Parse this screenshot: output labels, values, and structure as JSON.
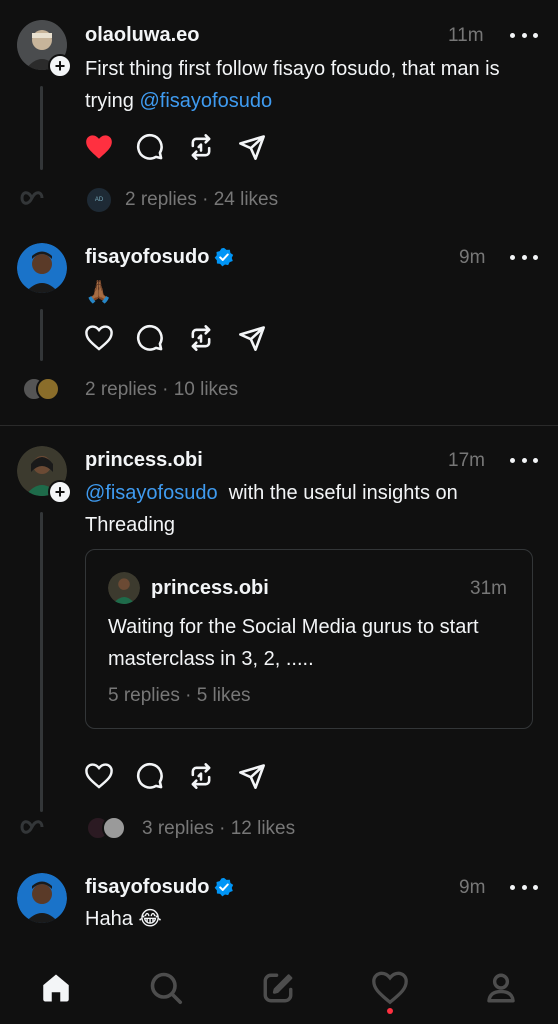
{
  "posts": [
    {
      "username": "olaoluwa.eo",
      "time": "11m",
      "text_line1": "First thing first follow fisayo fosudo, that man is",
      "text_line2_prefix": "trying ",
      "mention": "@fisayofosudo",
      "liked": true,
      "replies_meta": "2 replies · 24 likes",
      "mini_avatar_label": "AD"
    },
    {
      "username": "fisayofosudo",
      "verified": true,
      "time": "9m",
      "emoji": "🙏🏾",
      "liked": false,
      "replies_meta": "2 replies · 10 likes"
    },
    {
      "username": "princess.obi",
      "time": "17m",
      "mention": "@fisayofosudo",
      "text_after_mention": "with the useful insights on",
      "text_line2": "Threading",
      "liked": false,
      "replies_meta": "3 replies · 12 likes",
      "quote": {
        "username": "princess.obi",
        "time": "31m",
        "line1": "Waiting for the Social Media gurus to start",
        "line2": "masterclass in 3, 2, .....",
        "meta": "5 replies · 5 likes"
      }
    },
    {
      "username": "fisayofosudo",
      "verified": true,
      "time": "9m",
      "text": "Haha 😂"
    }
  ],
  "colors": {
    "background": "#101010",
    "text": "#f3f5f7",
    "muted": "#777777",
    "mention": "#3f9bf0",
    "like": "#ff3040",
    "verified": "#0095f6"
  },
  "tabbar": {
    "tabs": [
      "home-icon",
      "search-icon",
      "compose-icon",
      "activity-icon",
      "profile-icon"
    ],
    "active": "home-icon",
    "activity_dot": true
  }
}
